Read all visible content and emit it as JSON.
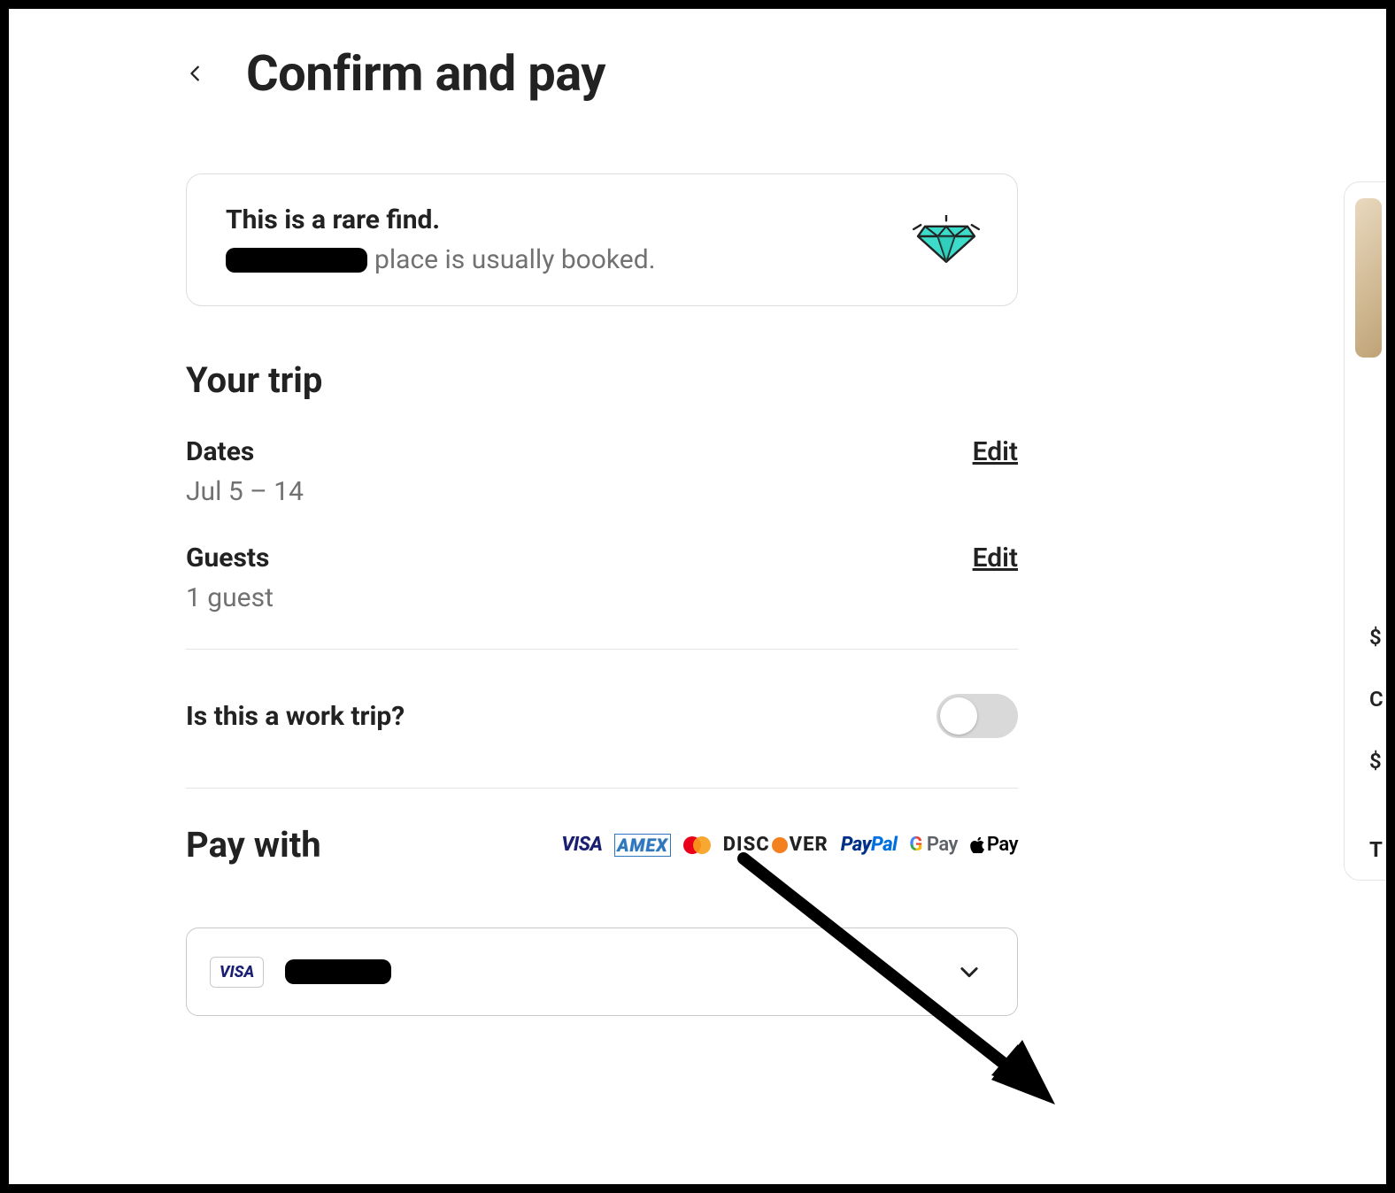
{
  "header": {
    "title": "Confirm and pay"
  },
  "rare_find": {
    "headline": "This is a rare find.",
    "subtext_suffix": "place is usually booked."
  },
  "trip": {
    "section_title": "Your trip",
    "dates_label": "Dates",
    "dates_value": "Jul 5 – 14",
    "dates_edit": "Edit",
    "guests_label": "Guests",
    "guests_value": "1 guest",
    "guests_edit": "Edit"
  },
  "work_trip": {
    "label": "Is this a work trip?",
    "enabled": false
  },
  "pay_with": {
    "title": "Pay with",
    "logos": {
      "visa": "VISA",
      "amex": "AMEX",
      "discover_pre": "DISC",
      "discover_post": "VER",
      "paypal_a": "Pay",
      "paypal_b": "Pal",
      "gpay_g": "G",
      "gpay_rest": " Pay",
      "applepay": "Pay"
    },
    "selected_card_brand": "VISA"
  }
}
